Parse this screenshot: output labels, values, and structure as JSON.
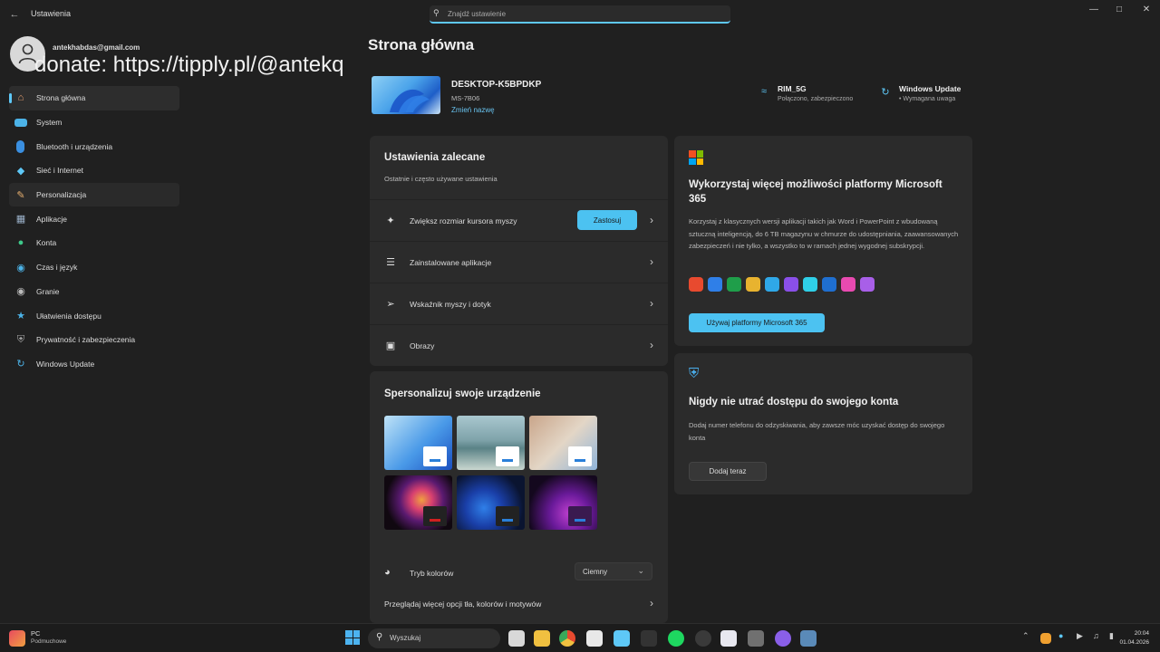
{
  "window": {
    "app_title": "Ustawienia",
    "search_placeholder": "Znajdź ustawienie"
  },
  "account": {
    "email": "antekhabdas@gmail.com"
  },
  "overlay": {
    "watermark": "donate: https://tipply.pl/@antekq"
  },
  "sidebar": {
    "items": [
      {
        "label": "Strona główna",
        "icon": "home-icon"
      },
      {
        "label": "System",
        "icon": "monitor-icon"
      },
      {
        "label": "Bluetooth i urządzenia",
        "icon": "bluetooth-icon"
      },
      {
        "label": "Sieć i Internet",
        "icon": "wifi-icon"
      },
      {
        "label": "Personalizacja",
        "icon": "brush-icon"
      },
      {
        "label": "Aplikacje",
        "icon": "apps-icon"
      },
      {
        "label": "Konta",
        "icon": "person-icon"
      },
      {
        "label": "Czas i język",
        "icon": "globe-clock-icon"
      },
      {
        "label": "Granie",
        "icon": "gamepad-icon"
      },
      {
        "label": "Ułatwienia dostępu",
        "icon": "accessibility-icon"
      },
      {
        "label": "Prywatność i zabezpieczenia",
        "icon": "shield-icon"
      },
      {
        "label": "Windows Update",
        "icon": "update-icon"
      }
    ]
  },
  "main": {
    "page_title": "Strona główna",
    "device": {
      "name": "DESKTOP-K5BPDKP",
      "model": "MS-7B06",
      "rename_link": "Zmień nazwę"
    },
    "status": {
      "network_title": "RIM_5G",
      "network_sub": "Połączono, zabezpieczono",
      "update_title": "Windows Update",
      "update_sub": "• Wymagana uwaga"
    },
    "recommended": {
      "title": "Ustawienia zalecane",
      "subtitle": "Ostatnie i często używane ustawienia",
      "rows": [
        {
          "label": "Zwiększ rozmiar kursora myszy",
          "button": "Zastosuj"
        },
        {
          "label": "Zainstalowane aplikacje"
        },
        {
          "label": "Wskaźnik myszy i dotyk"
        },
        {
          "label": "Obrazy"
        }
      ]
    },
    "personalize": {
      "title": "Spersonalizuj swoje urządzenie",
      "color_mode_label": "Tryb kolorów",
      "color_mode_value": "Ciemny",
      "more_link": "Przeglądaj więcej opcji tła, kolorów i motywów"
    },
    "m365": {
      "title": "Wykorzystaj więcej możliwości platformy Microsoft 365",
      "body": "Korzystaj z klasycznych wersji aplikacji takich jak Word i PowerPoint z wbudowaną sztuczną inteligencją, do 6 TB magazynu w chmurze do udostępniania, zaawansowanych zabezpieczeń i nie tylko, a wszystko to w ramach jednej wygodnej subskrypcji.",
      "button": "Używaj platformy Microsoft 365",
      "app_colors": [
        "#e84a2f",
        "#2f7fe8",
        "#1f9e4a",
        "#e8b32f",
        "#2fa8e8",
        "#8a4fe8",
        "#2fd0e8",
        "#1f6fd0",
        "#e84ab0",
        "#a85fe8"
      ]
    },
    "account_card": {
      "title": "Nigdy nie utrać dostępu do swojego konta",
      "body": "Dodaj numer telefonu do odzyskiwania, aby zawsze móc uzyskać dostęp do swojego konta",
      "button": "Dodaj teraz"
    }
  },
  "taskbar": {
    "weather_label": "PC",
    "weather_sub": "Podmuchowe",
    "search_label": "Wyszukaj",
    "time": "20:04",
    "date": "01.04.2026"
  },
  "colors": {
    "accent": "#4cc2f1",
    "background": "#202020",
    "card": "#2b2b2b"
  }
}
